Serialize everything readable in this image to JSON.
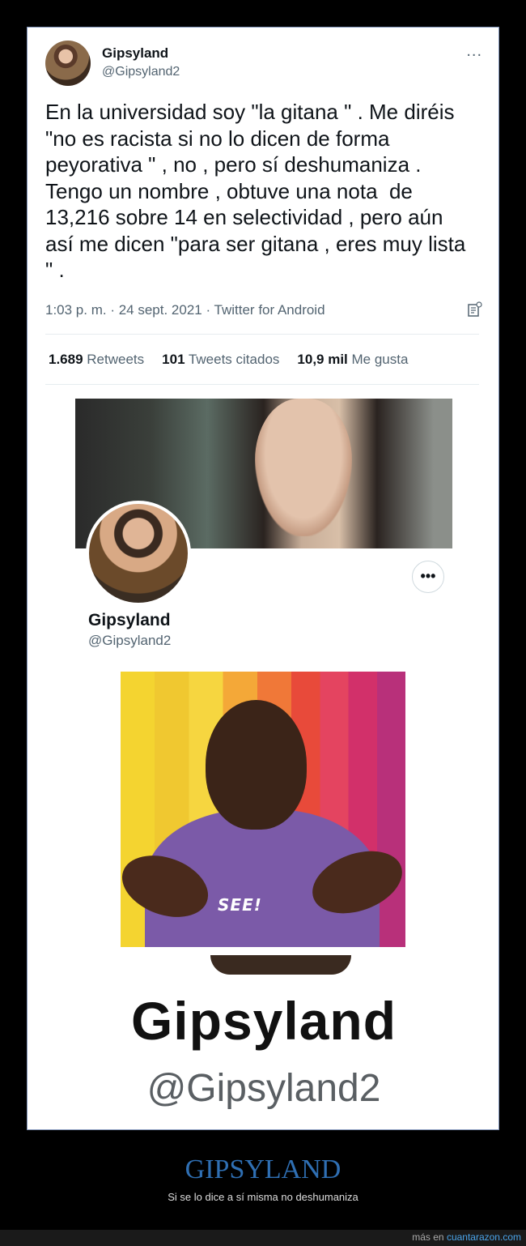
{
  "tweet": {
    "author_name": "Gipsyland",
    "author_handle": "@Gipsyland2",
    "more_icon": "...",
    "text": "En la universidad soy \"la gitana \" . Me diréis\n\"no es racista si no lo dicen de forma\npeyorativa \" , no , pero sí deshumaniza .\nTengo un nombre , obtuve una nota  de\n13,216 sobre 14 en selectividad , pero aún\nasí me dicen \"para ser gitana , eres muy lista\n\" .",
    "meta": "1:03 p. m. · 24 sept. 2021 · Twitter for Android",
    "analytics_icon": "analytics-icon"
  },
  "stats": [
    {
      "value": "1.689",
      "label": "Retweets"
    },
    {
      "value": "101",
      "label": "Tweets citados"
    },
    {
      "value": "10,9 mil",
      "label": "Me gusta"
    }
  ],
  "profile": {
    "name": "Gipsyland",
    "handle": "@Gipsyland2",
    "more_icon": "•••"
  },
  "gif": {
    "hoodie_text": "SEE!"
  },
  "zoomed_profile": {
    "name": "Gipsyland",
    "handle": "@Gipsyland2"
  },
  "caption": {
    "title": "GIPSYLAND",
    "subtitle": "Si se lo dice a sí misma no deshumaniza"
  },
  "footer": {
    "prefix": "más en",
    "site": "cuantarazon.com"
  },
  "colors": {
    "accent": "#2f6fb3",
    "link": "#4aa3e8",
    "text": "#0f1419",
    "secondary": "#536471"
  }
}
